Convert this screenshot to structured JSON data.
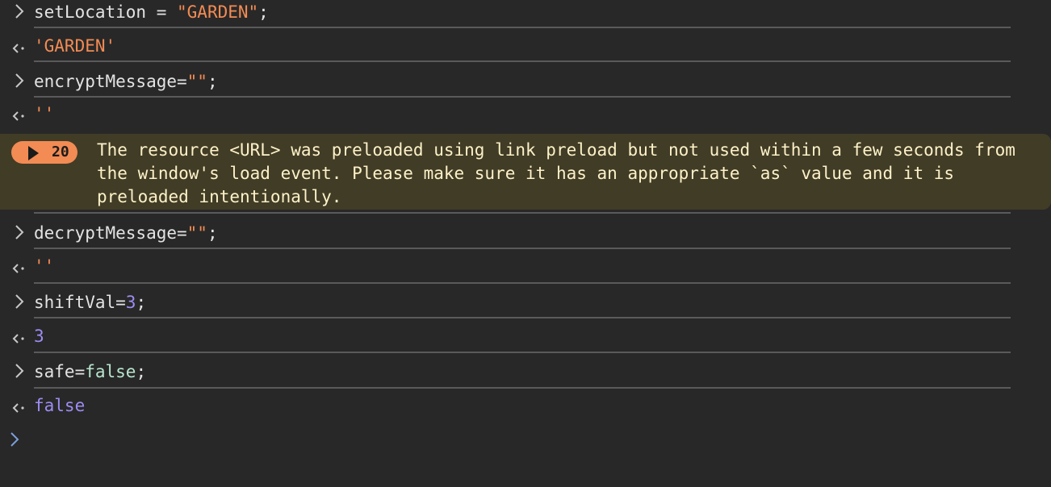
{
  "console": {
    "entries": [
      {
        "kind": "input",
        "pre": "setLocation = ",
        "value": "\"GARDEN\"",
        "post": ";"
      },
      {
        "kind": "result",
        "value": "'GARDEN'"
      },
      {
        "kind": "input",
        "pre": "encryptMessage=",
        "value": "\"\"",
        "post": ";"
      },
      {
        "kind": "result",
        "value": "''"
      },
      {
        "kind": "input",
        "pre": "decryptMessage=",
        "value": "\"\"",
        "post": ";"
      },
      {
        "kind": "result",
        "value": "''"
      },
      {
        "kind": "input",
        "pre": "shiftVal=",
        "value": "3",
        "post": ";"
      },
      {
        "kind": "result",
        "value": "3"
      },
      {
        "kind": "input",
        "pre": "safe=",
        "value": "false",
        "post": ";"
      },
      {
        "kind": "result",
        "value": "false"
      }
    ],
    "warning": {
      "count": "20",
      "message": "The resource <URL> was preloaded using link preload but not used within a few seconds from the window's load event. Please make sure it has an appropriate `as` value and it is preloaded intentionally."
    }
  },
  "colors": {
    "background": "#282828",
    "string": "#f28b54",
    "number": "#9e8cf2",
    "keyword": "#b8e5ce",
    "warning_bg": "#413c26",
    "warning_text": "#fdf1c8",
    "prompt": "#7c9fdb"
  }
}
